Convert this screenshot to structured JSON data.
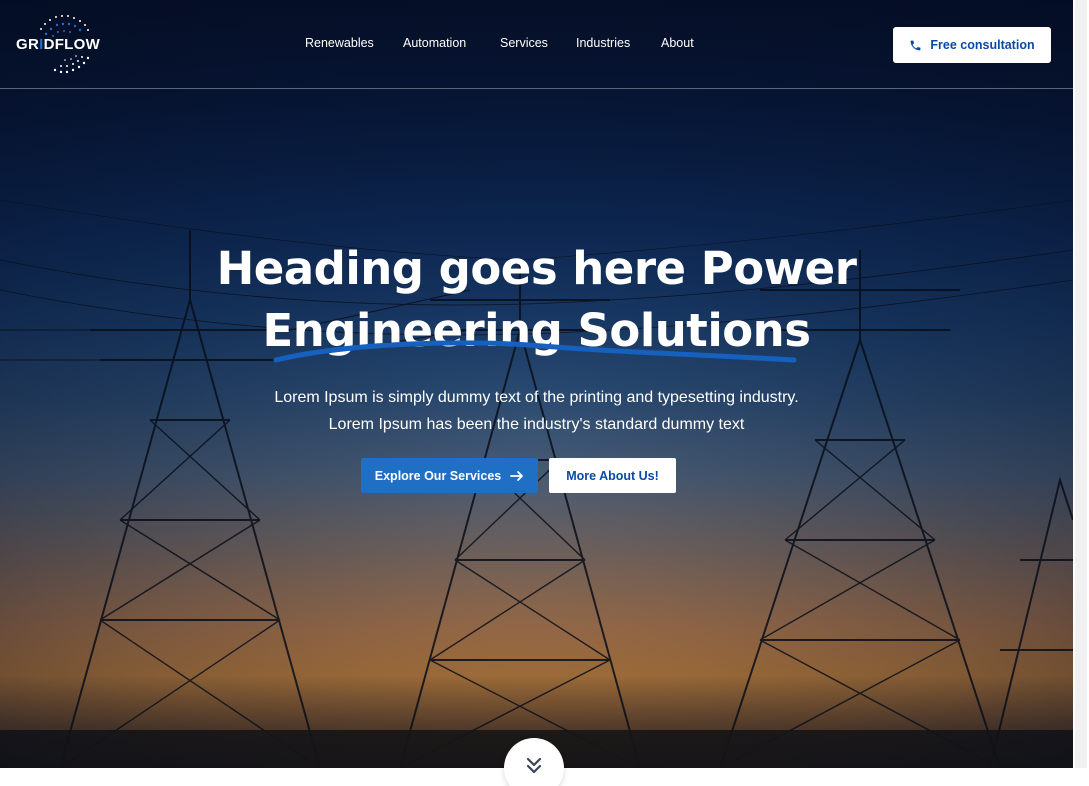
{
  "brand": {
    "logo_text_pre": "GR",
    "logo_text_mid": "I",
    "logo_text_post": "DFLOW",
    "accent_color": "#1f6fc5",
    "logo_icon": "dotted-circle-logo-icon"
  },
  "nav": {
    "items": [
      {
        "label": "Renewables"
      },
      {
        "label": "Automation"
      },
      {
        "label": "Services"
      },
      {
        "label": "Industries"
      },
      {
        "label": "About"
      }
    ],
    "cta_label": "Free consultation",
    "cta_icon": "phone-icon"
  },
  "hero": {
    "title_line1": "Heading goes here Power",
    "title_line2": "Engineering Solutions",
    "subtitle_line1": "Lorem Ipsum is simply dummy text of the printing and typesetting industry.",
    "subtitle_line2": "Lorem Ipsum has been the industry's standard dummy text",
    "primary_button": "Explore Our Services",
    "primary_button_icon": "arrow-right-icon",
    "secondary_button": "More About Us!",
    "scroll_icon": "double-chevron-down-icon",
    "background": "power transmission towers at sunset"
  }
}
